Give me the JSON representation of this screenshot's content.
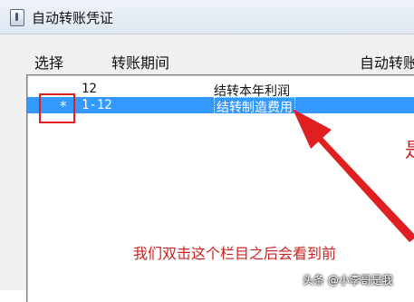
{
  "window": {
    "title": "自动转账凭证",
    "icon": "app-icon"
  },
  "columns": {
    "select": "选择",
    "period": "转账期间",
    "auto": "自动转账"
  },
  "rows": [
    {
      "selected": false,
      "mark": "",
      "period": "12",
      "name": "结转本年利润"
    },
    {
      "selected": true,
      "mark": "*",
      "period": "1-12",
      "name": "结转制造费用"
    }
  ],
  "annotation": {
    "text": "我们双击这个栏目之后会看到前",
    "edge_glyph": "是",
    "color": "#cc2222"
  },
  "watermark": "头条 @小李哥是我",
  "colors": {
    "selection": "#3399ff",
    "highlight_box": "#e02020",
    "arrow": "#e02020"
  }
}
